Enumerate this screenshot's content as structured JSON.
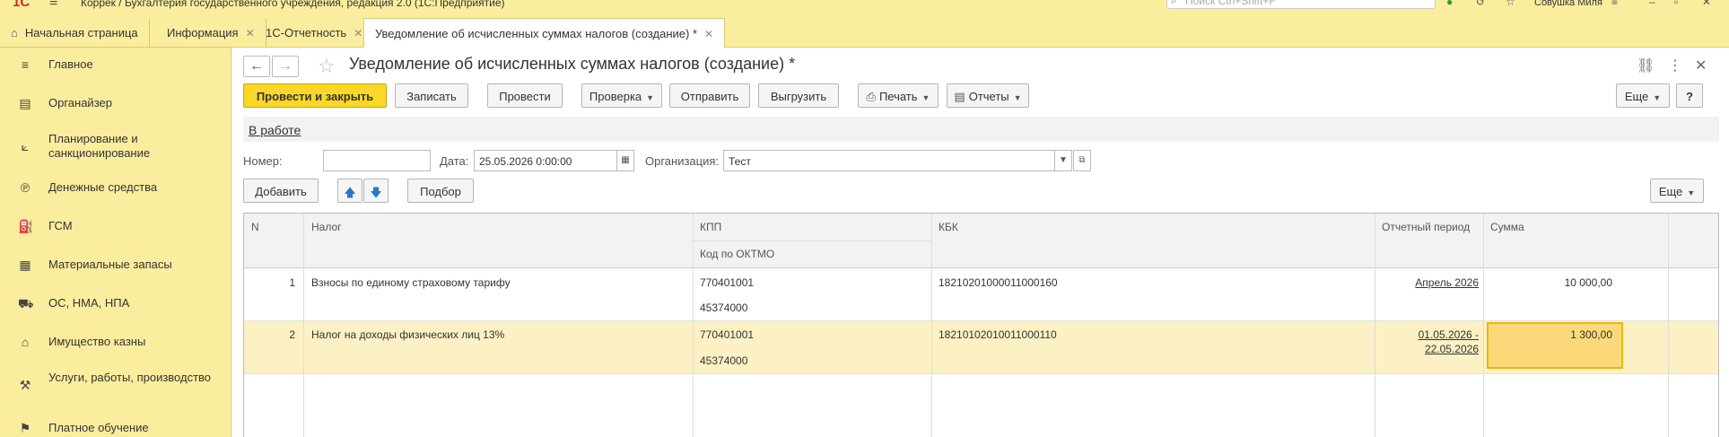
{
  "app": {
    "logo": "1С",
    "title": "Коррек / Бухгалтерия государственного учреждения, редакция 2.0  (1С:Предприятие)",
    "search_placeholder": "Поиск Ctrl+Shift+F",
    "user": "Совушка Миля"
  },
  "tabs": [
    {
      "label": "Начальная страница"
    },
    {
      "label": "Информация"
    },
    {
      "label": "1С-Отчетность"
    },
    {
      "label": "Уведомление об исчисленных суммах налогов (создание) *"
    }
  ],
  "sidebar": {
    "items": [
      {
        "label": "Главное",
        "icon": "menu-icon"
      },
      {
        "label": "Органайзер",
        "icon": "organizer-icon"
      },
      {
        "label": "Планирование и санкционирование",
        "icon": "planning-icon"
      },
      {
        "label": "Денежные средства",
        "icon": "money-icon"
      },
      {
        "label": "ГСМ",
        "icon": "fuel-icon"
      },
      {
        "label": "Материальные запасы",
        "icon": "grid-icon"
      },
      {
        "label": "ОС, НМА, НПА",
        "icon": "truck-icon"
      },
      {
        "label": "Имущество казны",
        "icon": "bank-icon"
      },
      {
        "label": "Услуги, работы, производство",
        "icon": "tools-icon"
      },
      {
        "label": "Платное обучение",
        "icon": "education-icon"
      }
    ]
  },
  "document": {
    "title": "Уведомление об исчисленных суммах налогов (создание) *",
    "status": "В работе",
    "number_label": "Номер:",
    "number_value": "",
    "date_label": "Дата:",
    "date_value": "25.05.2026  0:00:00",
    "org_label": "Организация:",
    "org_value": "Тест"
  },
  "toolbar": {
    "post_close": "Провести и закрыть",
    "save": "Записать",
    "post": "Провести",
    "check": "Проверка",
    "send": "Отправить",
    "export": "Выгрузить",
    "print": "Печать",
    "reports": "Отчеты",
    "more": "Еще",
    "help": "?"
  },
  "table_toolbar": {
    "add": "Добавить",
    "pick": "Подбор",
    "more": "Еще"
  },
  "table": {
    "headers": {
      "n": "N",
      "tax": "Налог",
      "kpp": "КПП",
      "oktmo": "Код по ОКТМО",
      "kbk": "КБК",
      "period": "Отчетный период",
      "sum": "Сумма"
    },
    "rows": [
      {
        "n": "1",
        "tax": "Взносы по единому страховому тарифу",
        "kpp": "770401001",
        "oktmo": "45374000",
        "kbk": "18210201000011000160",
        "period": "Апрель 2026",
        "sum": "10 000,00"
      },
      {
        "n": "2",
        "tax": "Налог на доходы физических лиц 13%",
        "kpp": "770401001",
        "oktmo": "45374000",
        "kbk": "18210102010011000110",
        "period_line1": "01.05.2026 -",
        "period_line2": "22.05.2026",
        "sum": "1 300,00"
      }
    ]
  },
  "colors": {
    "accent_yellow": "#fbed9e",
    "primary_button": "#fbd728",
    "selected_row": "#fcf1c4"
  }
}
